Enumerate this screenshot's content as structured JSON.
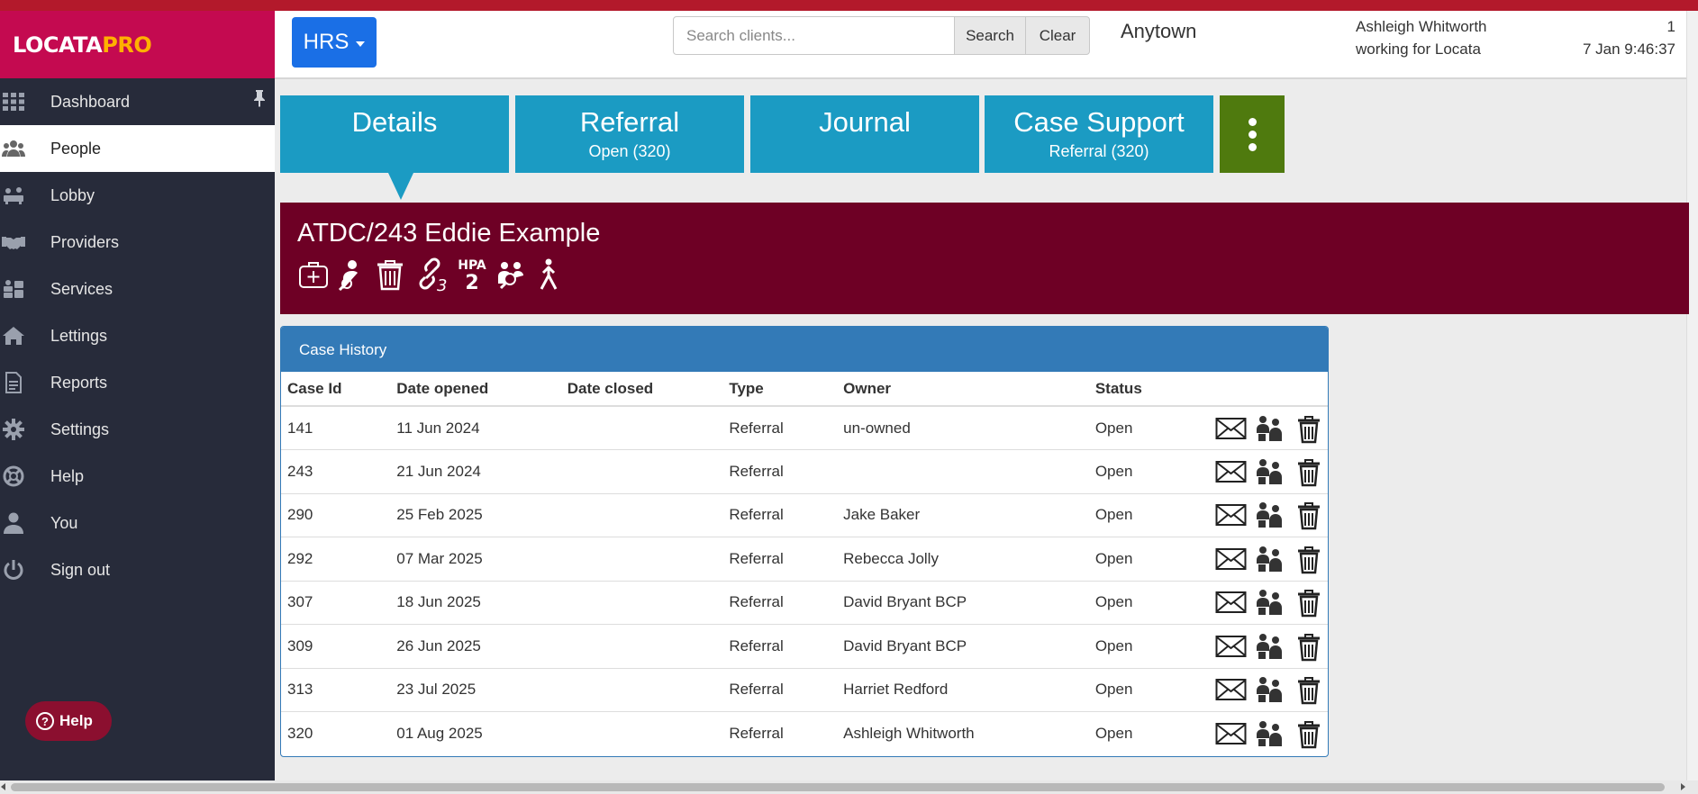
{
  "brand": {
    "logo_main": "LOCATA",
    "logo_accent": "PRO"
  },
  "sidebar": {
    "items": [
      {
        "label": "Dashboard",
        "icon": "grid-icon",
        "active": false
      },
      {
        "label": "People",
        "icon": "people-icon",
        "active": true
      },
      {
        "label": "Lobby",
        "icon": "lobby-icon",
        "active": false
      },
      {
        "label": "Providers",
        "icon": "handshake-icon",
        "active": false
      },
      {
        "label": "Services",
        "icon": "services-icon",
        "active": false
      },
      {
        "label": "Lettings",
        "icon": "home-icon",
        "active": false
      },
      {
        "label": "Reports",
        "icon": "report-icon",
        "active": false
      },
      {
        "label": "Settings",
        "icon": "gear-icon",
        "active": false
      },
      {
        "label": "Help",
        "icon": "lifebuoy-icon",
        "active": false
      },
      {
        "label": "You",
        "icon": "user-icon",
        "active": false
      },
      {
        "label": "Sign out",
        "icon": "power-icon",
        "active": false
      }
    ],
    "help_button": "Help"
  },
  "header": {
    "module_button": "HRS",
    "search": {
      "placeholder": "Search clients...",
      "value": "",
      "button": "Search",
      "clear": "Clear"
    },
    "location": "Anytown",
    "user": {
      "name": "Ashleigh Whitworth",
      "org": "working for Locata"
    },
    "count": "1",
    "datetime": "7 Jan 9:46:37"
  },
  "tabs": [
    {
      "title": "Details",
      "subtitle": ""
    },
    {
      "title": "Referral",
      "subtitle": "Open (320)"
    },
    {
      "title": "Journal",
      "subtitle": ""
    },
    {
      "title": "Case Support",
      "subtitle": "Referral (320)"
    }
  ],
  "client": {
    "name": "ATDC/243 Eddie Example",
    "icons": [
      "medical-bag-icon",
      "person-search-icon",
      "trash-icon",
      "link-3-icon",
      "hpa-2-icon",
      "group-search-icon",
      "walking-icon"
    ],
    "icon_labels": {
      "link_count": "3",
      "hpa": "HPA",
      "hpa_count": "2"
    }
  },
  "case_history": {
    "title": "Case History",
    "columns": [
      "Case Id",
      "Date opened",
      "Date closed",
      "Type",
      "Owner",
      "Status"
    ],
    "rows": [
      {
        "case_id": "141",
        "opened": "11 Jun 2024",
        "closed": "",
        "type": "Referral",
        "owner": "un-owned",
        "status": "Open"
      },
      {
        "case_id": "243",
        "opened": "21 Jun 2024",
        "closed": "",
        "type": "Referral",
        "owner": "",
        "status": "Open"
      },
      {
        "case_id": "290",
        "opened": "25 Feb 2025",
        "closed": "",
        "type": "Referral",
        "owner": "Jake Baker",
        "status": "Open"
      },
      {
        "case_id": "292",
        "opened": "07 Mar 2025",
        "closed": "",
        "type": "Referral",
        "owner": "Rebecca Jolly",
        "status": "Open"
      },
      {
        "case_id": "307",
        "opened": "18 Jun 2025",
        "closed": "",
        "type": "Referral",
        "owner": "David Bryant BCP",
        "status": "Open"
      },
      {
        "case_id": "309",
        "opened": "26 Jun 2025",
        "closed": "",
        "type": "Referral",
        "owner": "David Bryant BCP",
        "status": "Open"
      },
      {
        "case_id": "313",
        "opened": "23 Jul 2025",
        "closed": "",
        "type": "Referral",
        "owner": "Harriet Redford",
        "status": "Open"
      },
      {
        "case_id": "320",
        "opened": "01 Aug 2025",
        "closed": "",
        "type": "Referral",
        "owner": "Ashleigh Whitworth",
        "status": "Open"
      }
    ],
    "row_actions": [
      "mail-icon",
      "transfer-people-icon",
      "trash-icon"
    ]
  },
  "colors": {
    "brand": "#c40a50",
    "sidebar": "#272b3a",
    "tab": "#1b9bc3",
    "more_tab": "#4f7a0e",
    "client_banner": "#6e0025",
    "panel_header": "#337ab7",
    "primary_button": "#1a6fe6"
  }
}
